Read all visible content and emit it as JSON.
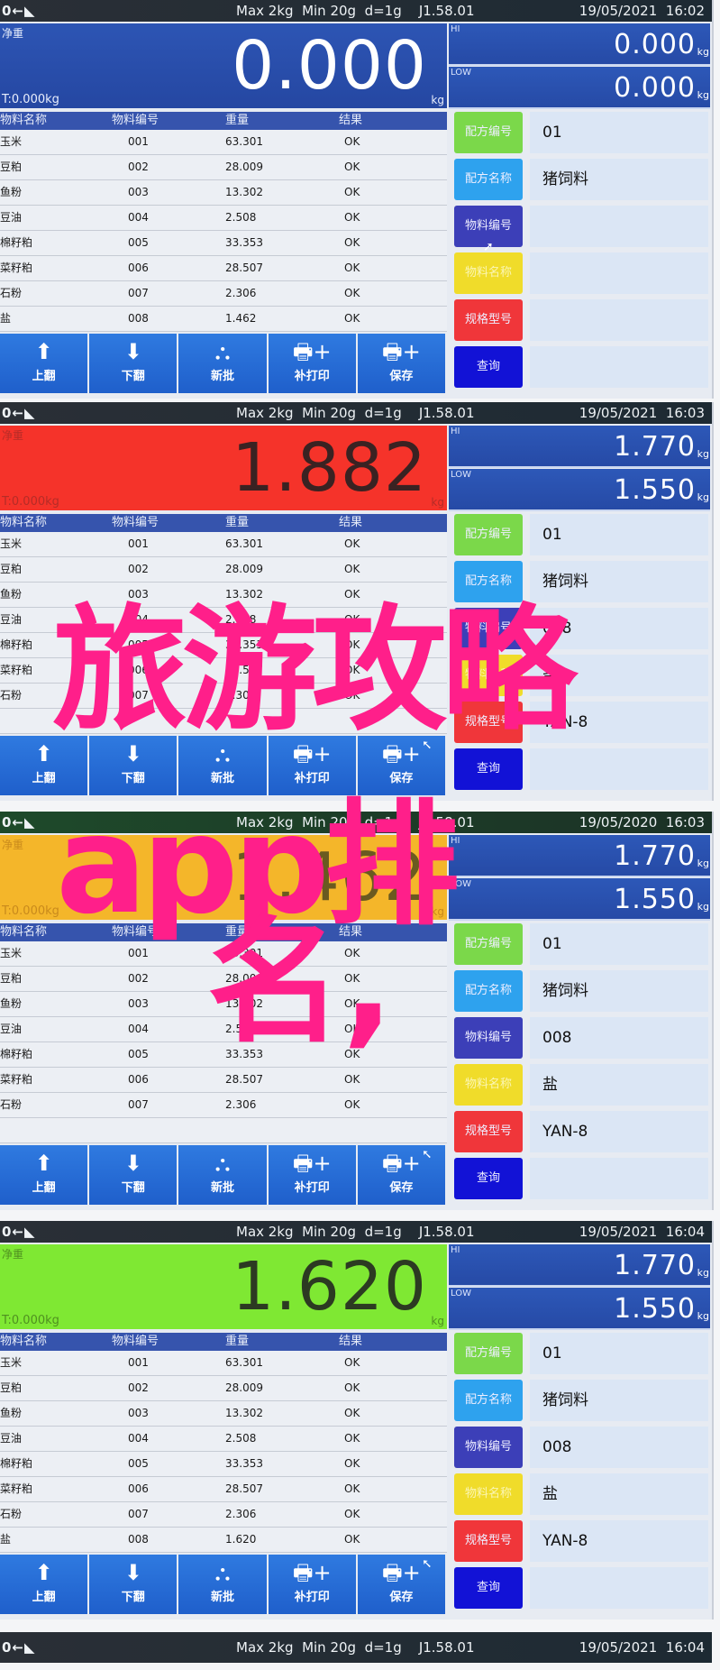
{
  "overlay_text": {
    "line1": "旅游攻略",
    "line2": "app排",
    "line3": "名,"
  },
  "colors": {
    "overlay": "#ff1f8a",
    "blue": "#2d55b4",
    "red": "#f5332a",
    "yellow": "#f4b62a",
    "green": "#7fe833"
  },
  "common": {
    "zero_indicator": "0←◣",
    "spec": "Max 2kg  Min 20g  d=1g    J1.58.01",
    "net_label": "净重",
    "tare": "T:0.000kg",
    "unit": "kg",
    "hi_label": "HI",
    "low_label": "LOW",
    "table_headers": [
      "物料名称",
      "物料编号",
      "重量",
      "结果"
    ],
    "toolbar": [
      {
        "icon": "arrow-up-icon",
        "label": "上翻"
      },
      {
        "icon": "arrow-down-icon",
        "label": "下翻"
      },
      {
        "icon": "batch-stack-icon",
        "label": "新批"
      },
      {
        "icon": "printer-plus-icon",
        "label": "补打印"
      },
      {
        "icon": "printer-plus-icon",
        "label": "保存"
      }
    ],
    "side_buttons": [
      {
        "label": "配方编号",
        "color": "#7bd84a"
      },
      {
        "label": "配方名称",
        "color": "#2ea2ee"
      },
      {
        "label": "物料编号",
        "color": "#3c3fb8"
      },
      {
        "label": "物料名称",
        "color": "#f0dc2a"
      },
      {
        "label": "规格型号",
        "color": "#f0363a"
      },
      {
        "label": "查询",
        "color": "#1212d6"
      }
    ]
  },
  "panels": [
    {
      "datetime": "19/05/2021  16:02",
      "weight": "0.000",
      "hi": "0.000",
      "low": "0.000",
      "rows": [
        [
          "玉米",
          "001",
          "63.301",
          "OK"
        ],
        [
          "豆粕",
          "002",
          "28.009",
          "OK"
        ],
        [
          "鱼粉",
          "003",
          "13.302",
          "OK"
        ],
        [
          "豆油",
          "004",
          "2.508",
          "OK"
        ],
        [
          "棉籽粕",
          "005",
          "33.353",
          "OK"
        ],
        [
          "菜籽粕",
          "006",
          "28.507",
          "OK"
        ],
        [
          "石粉",
          "007",
          "2.306",
          "OK"
        ],
        [
          "盐",
          "008",
          "1.462",
          "OK"
        ]
      ],
      "info": [
        "01",
        "猪饲料",
        "",
        "",
        "",
        ""
      ]
    },
    {
      "datetime": "19/05/2021  16:03",
      "weight": "1.882",
      "hi": "1.770",
      "low": "1.550",
      "rows": [
        [
          "玉米",
          "001",
          "63.301",
          "OK"
        ],
        [
          "豆粕",
          "002",
          "28.009",
          "OK"
        ],
        [
          "鱼粉",
          "003",
          "13.302",
          "OK"
        ],
        [
          "豆油",
          "004",
          "2.508",
          "OK"
        ],
        [
          "棉籽粕",
          "005",
          "33.353",
          "OK"
        ],
        [
          "菜籽粕",
          "006",
          "28.507",
          "OK"
        ],
        [
          "石粉",
          "007",
          "2.306",
          "OK"
        ],
        [
          "",
          "",
          "",
          ""
        ]
      ],
      "info": [
        "01",
        "猪饲料",
        "008",
        "盐",
        "YAN-8",
        ""
      ]
    },
    {
      "datetime": "19/05/2020  16:03",
      "weight": "1.462",
      "hi": "1.770",
      "low": "1.550",
      "rows": [
        [
          "玉米",
          "001",
          "63.301",
          "OK"
        ],
        [
          "豆粕",
          "002",
          "28.009",
          "OK"
        ],
        [
          "鱼粉",
          "003",
          "13.302",
          "OK"
        ],
        [
          "豆油",
          "004",
          "2.508",
          "OK"
        ],
        [
          "棉籽粕",
          "005",
          "33.353",
          "OK"
        ],
        [
          "菜籽粕",
          "006",
          "28.507",
          "OK"
        ],
        [
          "石粉",
          "007",
          "2.306",
          "OK"
        ],
        [
          "",
          "",
          "",
          ""
        ]
      ],
      "info": [
        "01",
        "猪饲料",
        "008",
        "盐",
        "YAN-8",
        ""
      ]
    },
    {
      "datetime": "19/05/2021  16:04",
      "weight": "1.620",
      "hi": "1.770",
      "low": "1.550",
      "rows": [
        [
          "玉米",
          "001",
          "63.301",
          "OK"
        ],
        [
          "豆粕",
          "002",
          "28.009",
          "OK"
        ],
        [
          "鱼粉",
          "003",
          "13.302",
          "OK"
        ],
        [
          "豆油",
          "004",
          "2.508",
          "OK"
        ],
        [
          "棉籽粕",
          "005",
          "33.353",
          "OK"
        ],
        [
          "菜籽粕",
          "006",
          "28.507",
          "OK"
        ],
        [
          "石粉",
          "007",
          "2.306",
          "OK"
        ],
        [
          "盐",
          "008",
          "1.620",
          "OK"
        ]
      ],
      "info": [
        "01",
        "猪饲料",
        "008",
        "盐",
        "YAN-8",
        ""
      ]
    }
  ],
  "partial_panel": {
    "zero_indicator": "0←◣",
    "spec": "Max 2kg  Min 20g  d=1g    J1.58.01",
    "datetime": "19/05/2021  16:04"
  }
}
